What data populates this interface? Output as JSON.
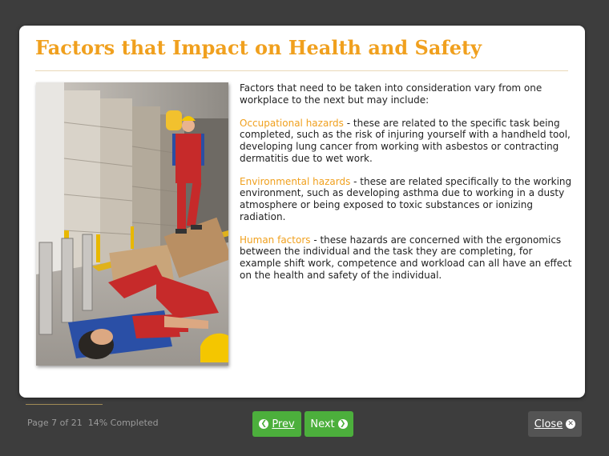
{
  "page": {
    "title": "Factors that Impact on Health and Safety",
    "intro": "Factors that need to be taken into consideration vary from one workplace to the next but may include:",
    "sections": [
      {
        "heading": "Occupational hazards",
        "text": " - these are related to the specific task being completed, such as the risk of injuring yourself with a handheld tool, developing lung cancer from working with asbestos or contracting dermatitis due to wet work."
      },
      {
        "heading": "Environmental hazards",
        "text": " - these are related specifically to the working environment, such as developing asthma due to working in a dusty atmosphere or being exposed to toxic substances or ionizing radiation."
      },
      {
        "heading": "Human factors",
        "text": " - these hazards are concerned with the ergonomics between the individual and the task they are completing, for example shift work, competence and workload can all have an effect on the health and safety of the individual."
      }
    ]
  },
  "footer": {
    "page_info": "Page 7 of 21",
    "completed": "14% Completed",
    "progress_fraction": 0.14,
    "prev_label": "Prev",
    "next_label": "Next",
    "close_label": "Close"
  },
  "colors": {
    "accent": "#f0a01e",
    "button": "#4caf3c",
    "background": "#3d3d3d"
  },
  "icons": {
    "prev": "chevron-left-circle-icon",
    "next": "chevron-right-circle-icon",
    "close": "close-circle-icon"
  }
}
